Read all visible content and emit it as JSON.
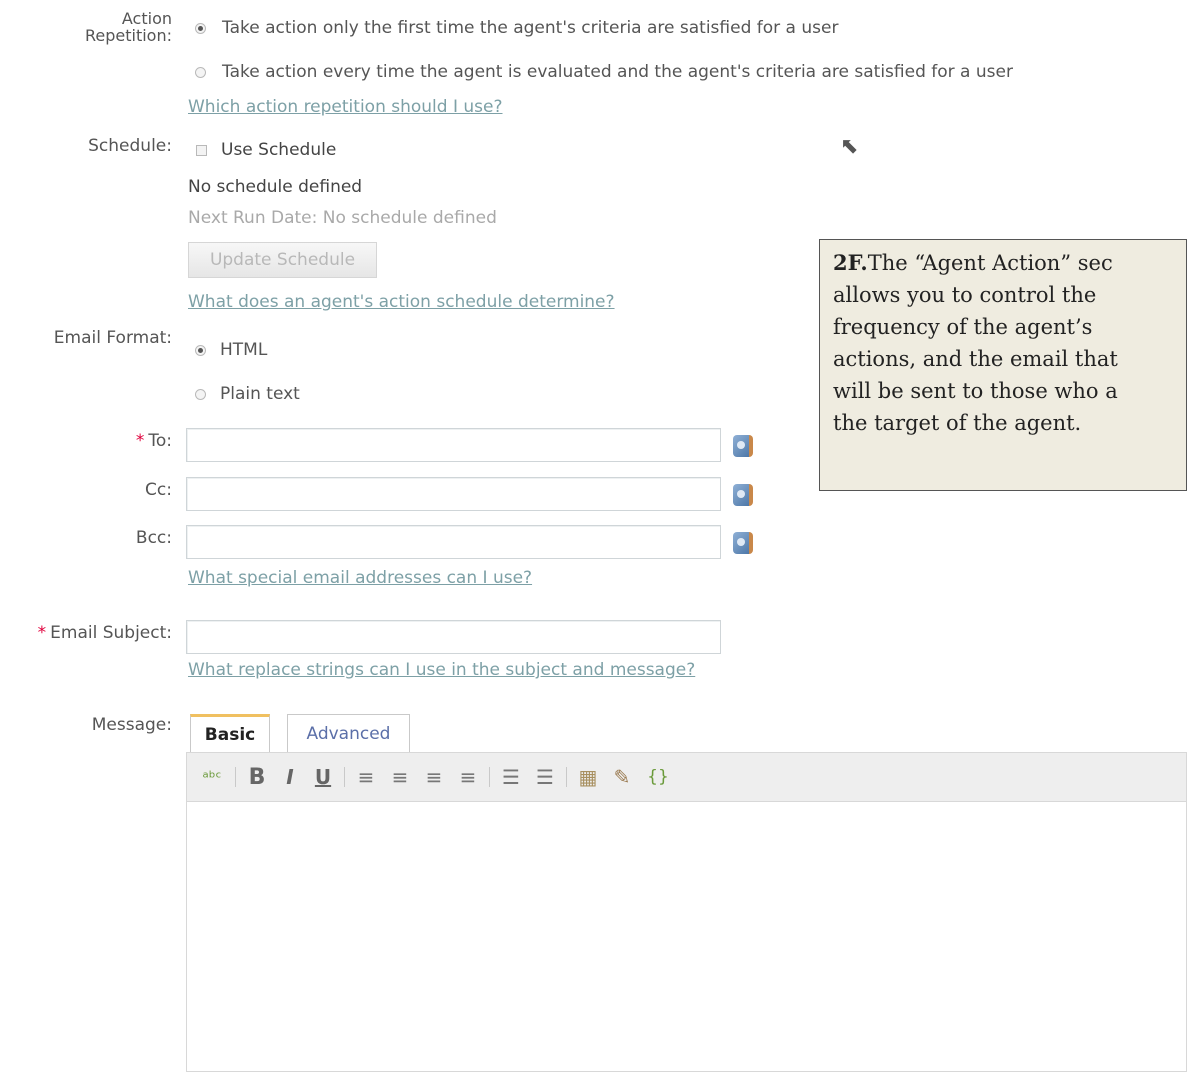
{
  "action_repetition": {
    "label_line1": "Action",
    "label_line2": "Repetition:",
    "option_first": "Take action only the first time the agent's criteria are satisfied for a user",
    "option_every": "Take action every time the agent is evaluated and the agent's criteria are satisfied for a user",
    "help_link": "Which action repetition should I use?"
  },
  "schedule": {
    "label": "Schedule:",
    "use_schedule_label": "Use Schedule",
    "status": "No schedule defined",
    "next_run": "Next Run Date: No schedule defined",
    "update_button": "Update Schedule",
    "help_link": "What does an agent's action schedule determine?"
  },
  "email_format": {
    "label": "Email Format:",
    "option_html": "HTML",
    "option_plain": "Plain text"
  },
  "recipients": {
    "required_marker": "*",
    "to_label": "To:",
    "cc_label": "Cc:",
    "bcc_label": "Bcc:",
    "to_value": "",
    "cc_value": "",
    "bcc_value": "",
    "help_link": "What special email addresses can I use?"
  },
  "subject": {
    "required_marker": "*",
    "label": "Email Subject:",
    "value": "",
    "help_link": "What replace strings can I use in the subject and message?"
  },
  "message": {
    "label": "Message:",
    "tab_basic": "Basic",
    "tab_advanced": "Advanced",
    "toolbar": {
      "spellcheck_glyph": "ᵃᵇᶜ",
      "bold": "B",
      "italic": "I",
      "underline": "U",
      "align_left": "≡",
      "align_center": "≡",
      "align_right": "≡",
      "align_justify": "≡",
      "bulleted_list": "☰",
      "numbered_list": "☰",
      "insert_table": "▦",
      "insert_link": "✎",
      "insert_replace_string": "{}"
    }
  },
  "callout": {
    "bold_prefix": "2F.",
    "line1": "The “Agent Action” sec",
    "line2": "allows you to control the",
    "line3": "frequency of the agent’s",
    "line4": "actions, and the email that",
    "line5": "will be sent to those who a",
    "line6": "the target of the agent."
  },
  "cursor": {
    "glyph": "⬉"
  }
}
